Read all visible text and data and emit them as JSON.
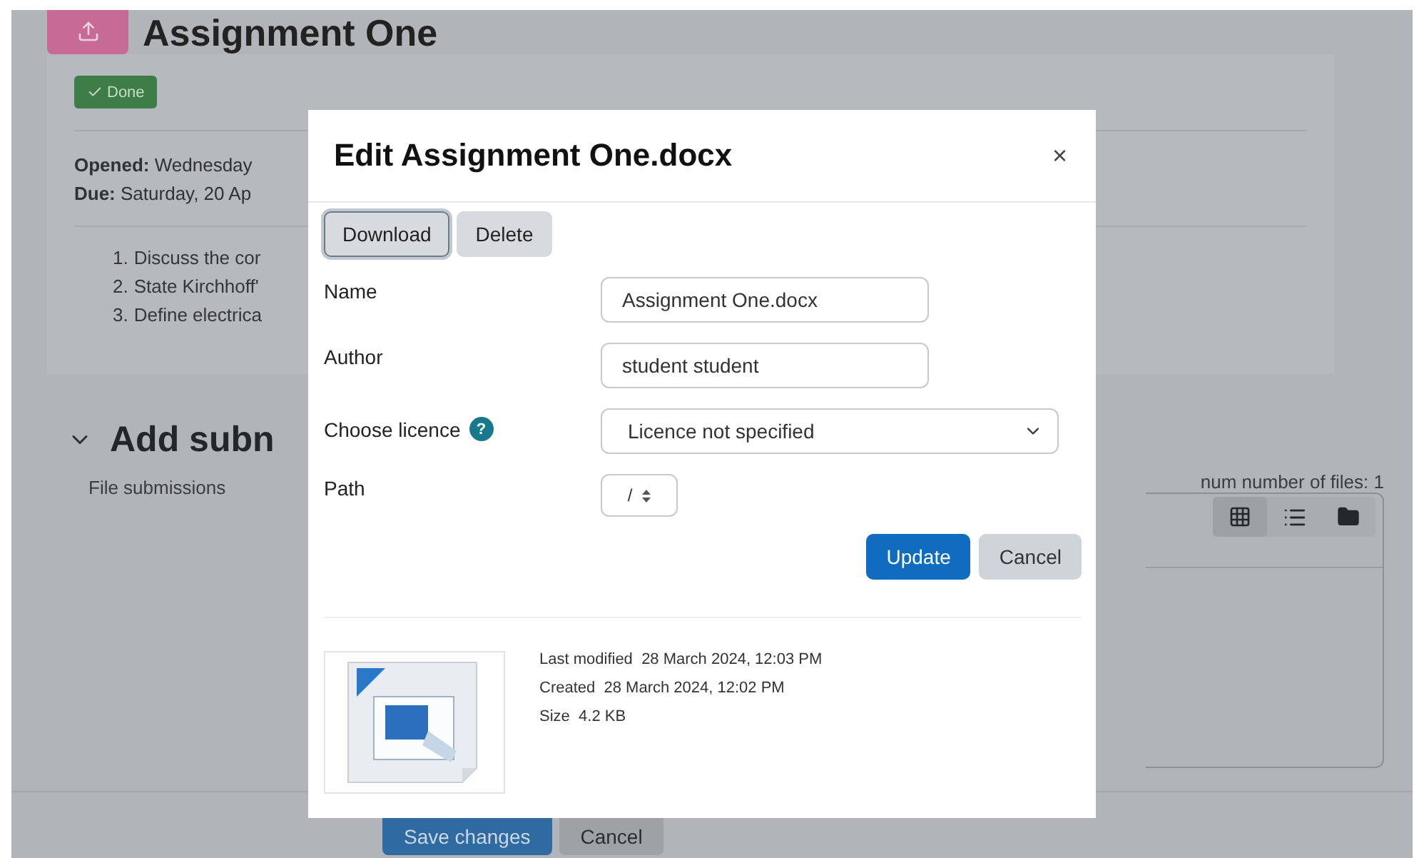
{
  "page": {
    "title": "Assignment One",
    "done_button": "Done",
    "dates": [
      {
        "label": "Opened:",
        "value": "Wednesday"
      },
      {
        "label": "Due:",
        "value": "Saturday, 20 Ap"
      }
    ],
    "tasks": [
      {
        "marker": "1.",
        "text": "Discuss the cor"
      },
      {
        "marker": "2.",
        "text": "State Kirchhoff'"
      },
      {
        "marker": "3.",
        "text": "Define electrica"
      }
    ],
    "section": {
      "title": "Add subn",
      "expanded": true
    },
    "file_submissions_label": "File submissions",
    "max_files": "num number of files: 1",
    "view_buttons": [
      {
        "kind": "grid",
        "selected": true
      },
      {
        "kind": "list",
        "selected": false
      },
      {
        "kind": "folder",
        "selected": false
      }
    ],
    "footer_buttons": [
      {
        "label": "Save changes",
        "kind": "primary"
      },
      {
        "label": "Cancel",
        "kind": "secondary"
      }
    ]
  },
  "dialog": {
    "title": "Edit Assignment One.docx",
    "close": "×",
    "actions": [
      {
        "label": "Download",
        "focused": true
      },
      {
        "label": "Delete",
        "focused": false
      }
    ],
    "fields": [
      {
        "kind": "text",
        "label": "Name",
        "value": "Assignment One.docx"
      },
      {
        "kind": "text",
        "label": "Author",
        "value": "student student"
      },
      {
        "kind": "select",
        "label": "Choose licence",
        "help": "?",
        "value": "Licence not specified"
      },
      {
        "kind": "path",
        "label": "Path",
        "value": "/"
      }
    ],
    "buttons": [
      {
        "label": "Update",
        "kind": "primary"
      },
      {
        "label": "Cancel",
        "kind": "secondary"
      }
    ],
    "file_info": [
      {
        "label": "Last modified",
        "value": "28 March 2024, 12:03 PM"
      },
      {
        "label": "Created",
        "value": "28 March 2024, 12:02 PM"
      },
      {
        "label": "Size",
        "value": "4.2 KB"
      }
    ]
  }
}
